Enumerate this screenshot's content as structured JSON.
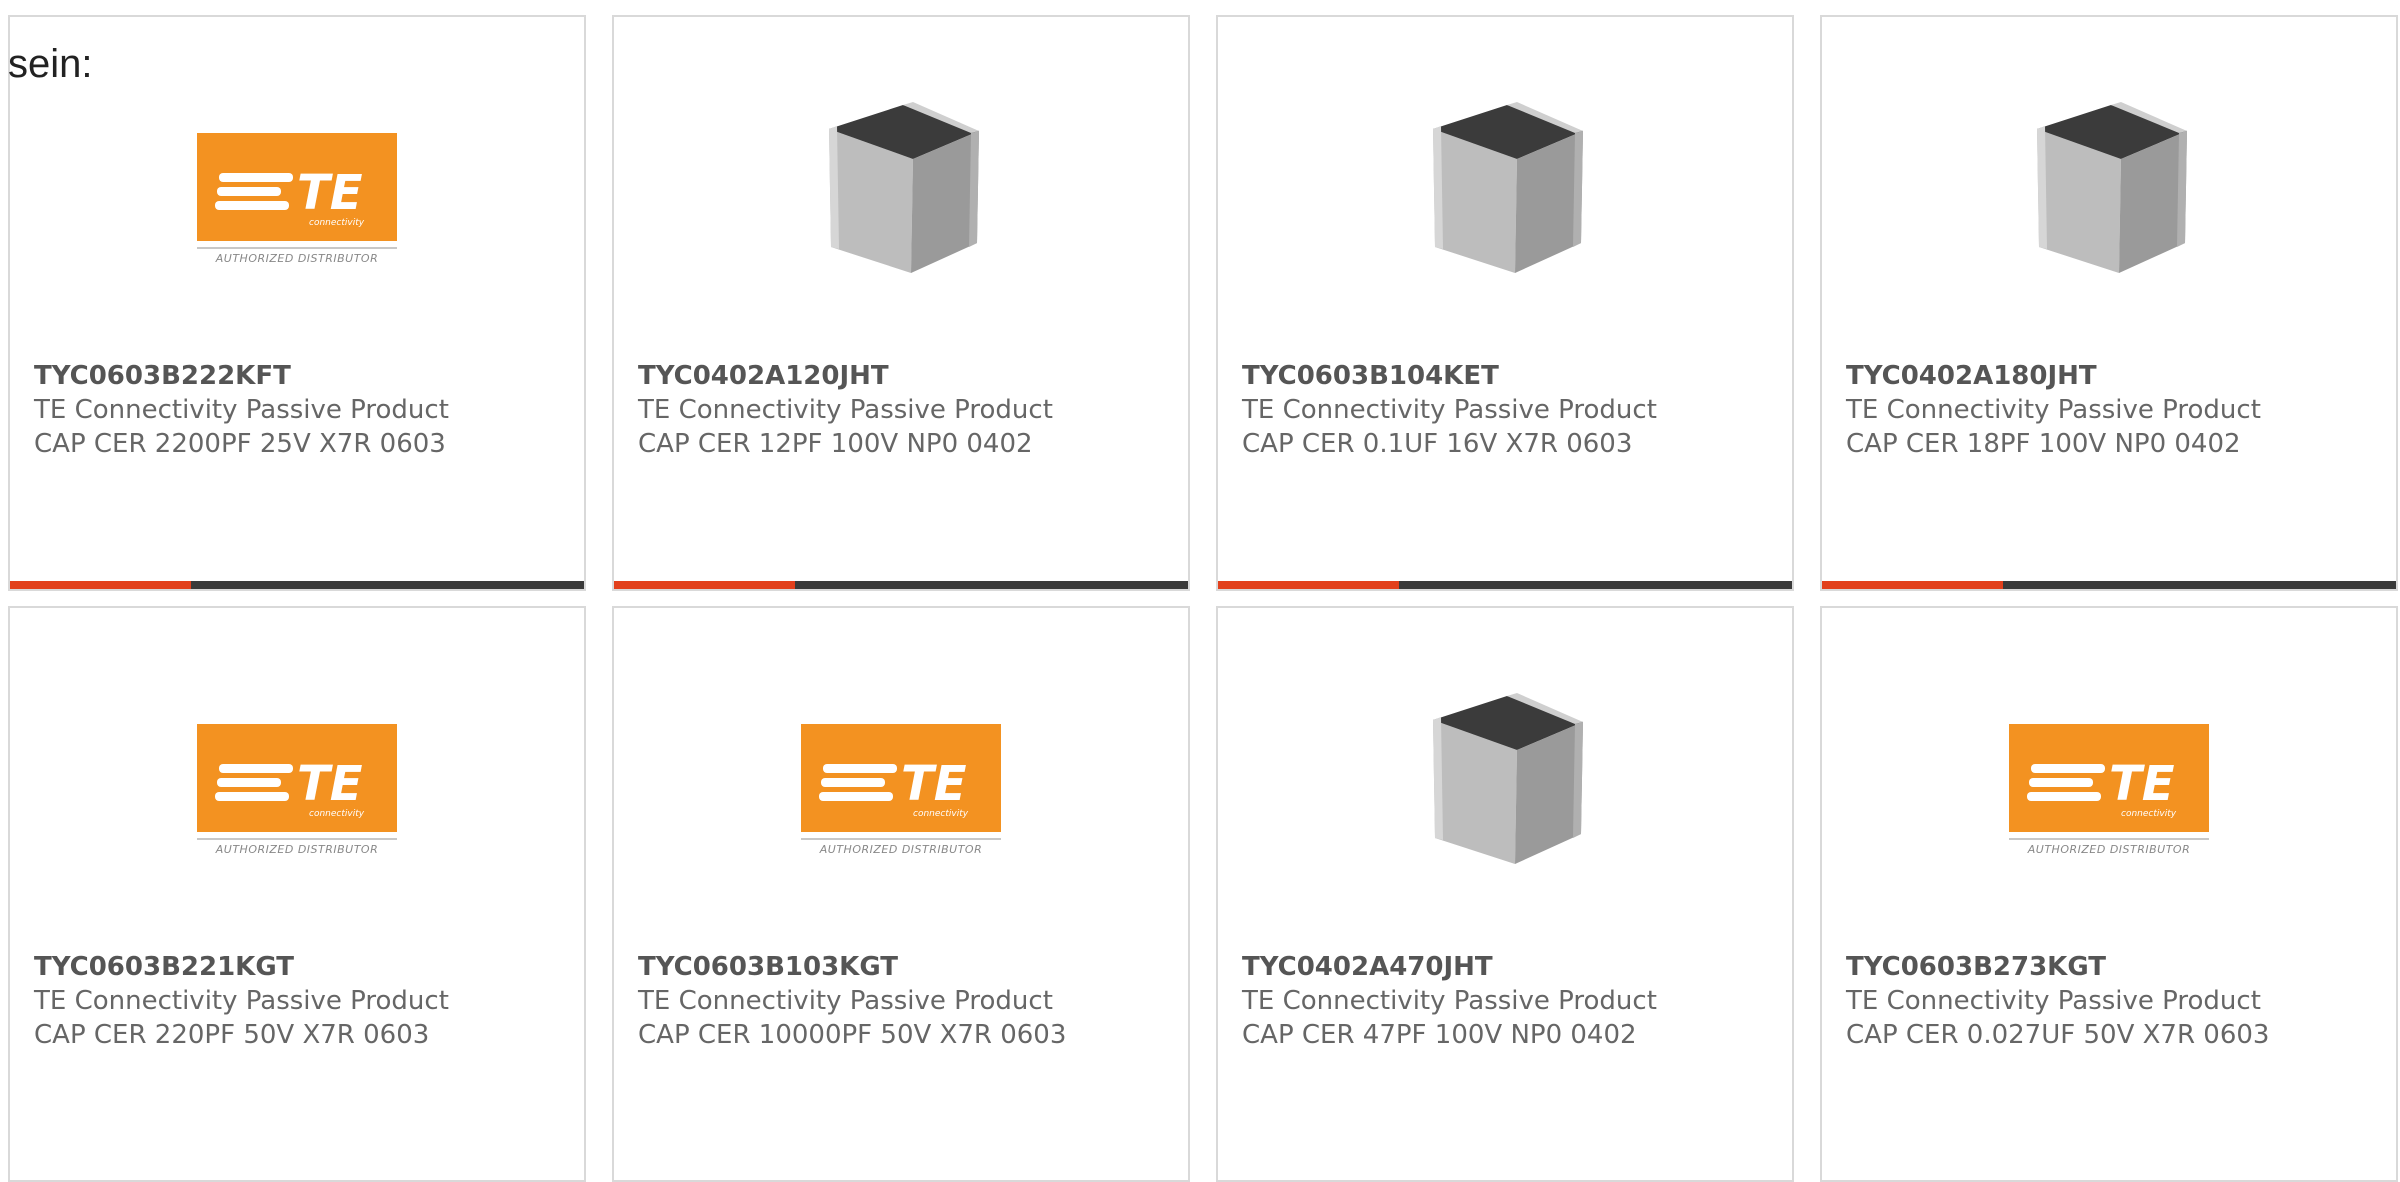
{
  "intro_text": "sein:",
  "logo": {
    "authorized_text": "AUTHORIZED DISTRIBUTOR",
    "brand_text": "TE",
    "sub_text": "connectivity",
    "color": "#f39221"
  },
  "accent_colors": {
    "bar_accent": "#e2401c",
    "bar_base": "#3a3a3a"
  },
  "products": [
    {
      "part": "TYC0603B222KFT",
      "manufacturer": "TE Connectivity Passive Product",
      "description": "CAP CER 2200PF 25V X7R 0603",
      "image": "te-logo",
      "has_bar": true
    },
    {
      "part": "TYC0402A120JHT",
      "manufacturer": "TE Connectivity Passive Product",
      "description": "CAP CER 12PF 100V NP0 0402",
      "image": "chip",
      "has_bar": true
    },
    {
      "part": "TYC0603B104KET",
      "manufacturer": "TE Connectivity Passive Product",
      "description": "CAP CER 0.1UF 16V X7R 0603",
      "image": "chip",
      "has_bar": true
    },
    {
      "part": "TYC0402A180JHT",
      "manufacturer": "TE Connectivity Passive Product",
      "description": "CAP CER 18PF 100V NP0 0402",
      "image": "chip",
      "has_bar": true
    },
    {
      "part": "TYC0603B221KGT",
      "manufacturer": "TE Connectivity Passive Product",
      "description": "CAP CER 220PF 50V X7R 0603",
      "image": "te-logo",
      "has_bar": false
    },
    {
      "part": "TYC0603B103KGT",
      "manufacturer": "TE Connectivity Passive Product",
      "description": "CAP CER 10000PF 50V X7R 0603",
      "image": "te-logo",
      "has_bar": false
    },
    {
      "part": "TYC0402A470JHT",
      "manufacturer": "TE Connectivity Passive Product",
      "description": "CAP CER 47PF 100V NP0 0402",
      "image": "chip",
      "has_bar": false
    },
    {
      "part": "TYC0603B273KGT",
      "manufacturer": "TE Connectivity Passive Product",
      "description": "CAP CER 0.027UF 50V X7R 0603",
      "image": "te-logo",
      "has_bar": false
    }
  ]
}
